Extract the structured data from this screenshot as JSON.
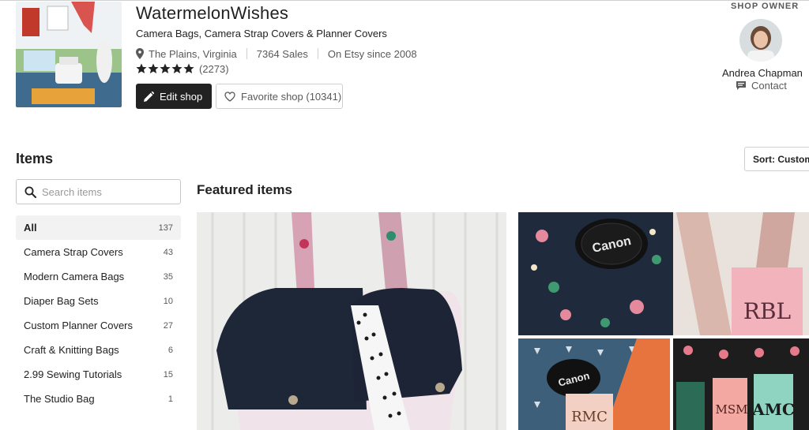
{
  "shop": {
    "name": "WatermelonWishes",
    "tagline": "Camera Bags, Camera Strap Covers & Planner Covers",
    "location": "The Plains, Virginia",
    "sales": "7364 Sales",
    "since": "On Etsy since 2008",
    "rating_stars": 5,
    "review_count": "(2273)"
  },
  "buttons": {
    "edit_label": "Edit shop",
    "favorite_label": "Favorite shop (10341)"
  },
  "owner": {
    "label": "SHOP OWNER",
    "name": "Andrea Chapman",
    "contact_label": "Contact"
  },
  "sidebar": {
    "heading": "Items",
    "search_placeholder": "Search items",
    "categories": [
      {
        "label": "All",
        "count": "137",
        "active": true
      },
      {
        "label": "Camera Strap Covers",
        "count": "43"
      },
      {
        "label": "Modern Camera Bags",
        "count": "35"
      },
      {
        "label": "Diaper Bag Sets",
        "count": "10"
      },
      {
        "label": "Custom Planner Covers",
        "count": "27"
      },
      {
        "label": "Craft & Knitting Bags",
        "count": "6"
      },
      {
        "label": "2.99 Sewing Tutorials",
        "count": "15"
      },
      {
        "label": "The Studio Bag",
        "count": "1"
      }
    ]
  },
  "main": {
    "featured_heading": "Featured items",
    "sort_label": "Sort: Custom",
    "photo_text": {
      "lens_cap_1": "Canon",
      "monogram_1": "RBL",
      "lens_cap_2": "Canon",
      "monogram_2": "RMC",
      "monogram_3": "MSM",
      "monogram_4": "AMC"
    }
  },
  "colors": {
    "accent_dark": "#222222",
    "star": "#222222",
    "muted_text": "#595959",
    "border": "#cfcfcf",
    "active_bg": "#f2f2f2"
  }
}
